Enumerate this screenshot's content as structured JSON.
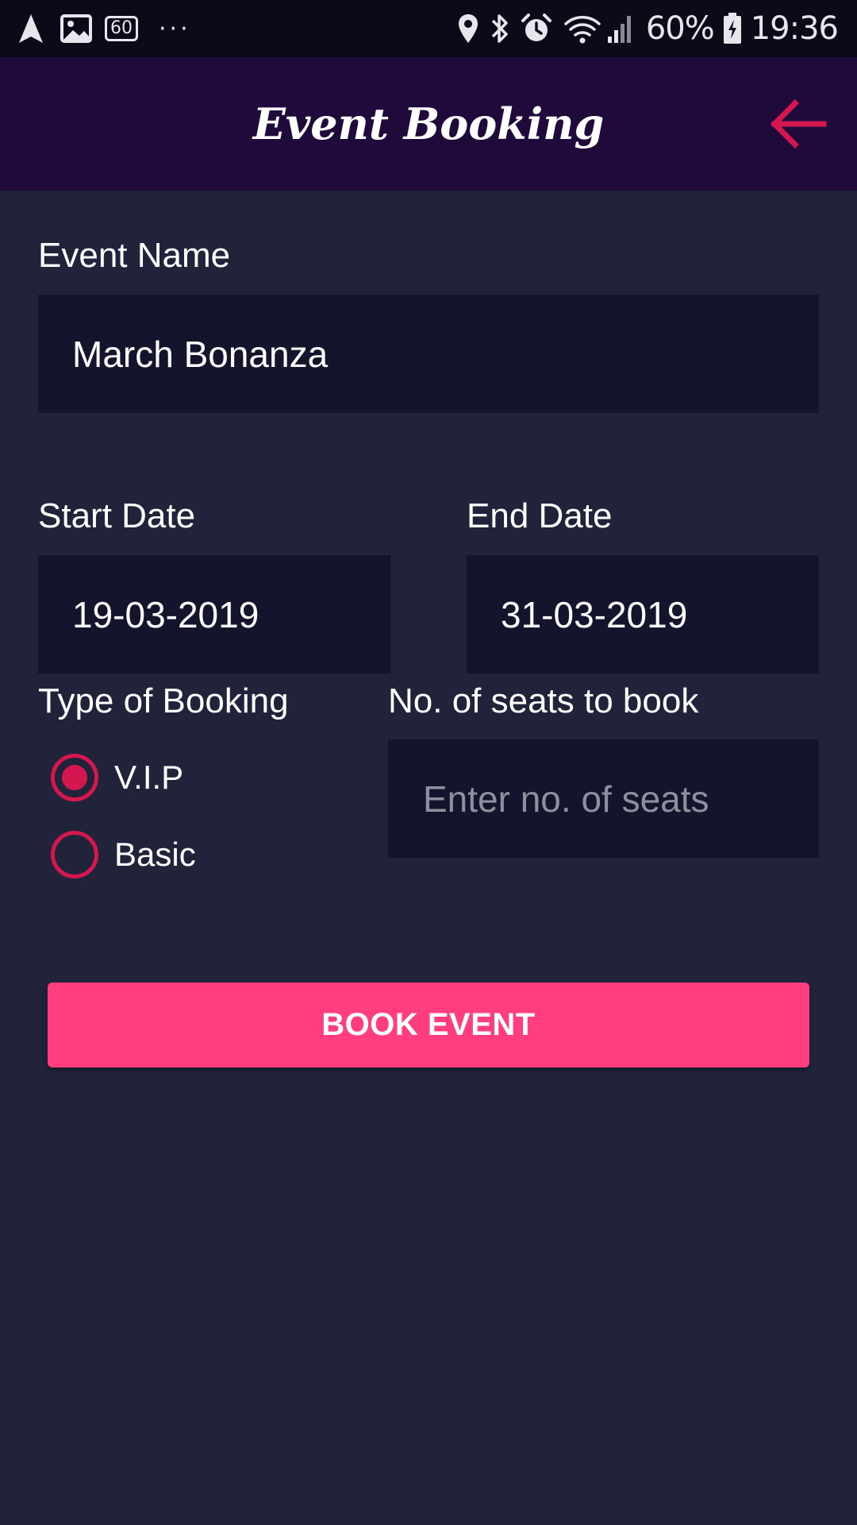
{
  "status_bar": {
    "left_icons": [
      "navigation-icon",
      "image-icon",
      "sixty-fps-icon",
      "more-dots-icon"
    ],
    "fps_badge": "60",
    "more": "···",
    "right_icons": [
      "location-icon",
      "bluetooth-icon",
      "alarm-icon",
      "wifi-icon",
      "signal-icon",
      "battery-charging-icon"
    ],
    "battery": "60%",
    "time": "19:36"
  },
  "header": {
    "title": "Event Booking",
    "back_icon": "back-arrow-icon",
    "background": "#1f0a3b",
    "accent": "#d5174f"
  },
  "form": {
    "event_name": {
      "label": "Event Name",
      "value": "March Bonanza"
    },
    "start_date": {
      "label": "Start Date",
      "value": "19-03-2019"
    },
    "end_date": {
      "label": "End Date",
      "value": "31-03-2019"
    },
    "booking_type": {
      "label": "Type of Booking",
      "options": [
        {
          "label": "V.I.P",
          "selected": true
        },
        {
          "label": "Basic",
          "selected": false
        }
      ]
    },
    "seats": {
      "label": "No. of seats to book",
      "value": "",
      "placeholder": "Enter no. of seats"
    },
    "submit_label": "BOOK EVENT"
  },
  "colors": {
    "background": "#20233a",
    "field_background": "#14152c",
    "button": "#ff3d7f",
    "radio": "#d5174f",
    "status_bar": "#0b0a18"
  }
}
